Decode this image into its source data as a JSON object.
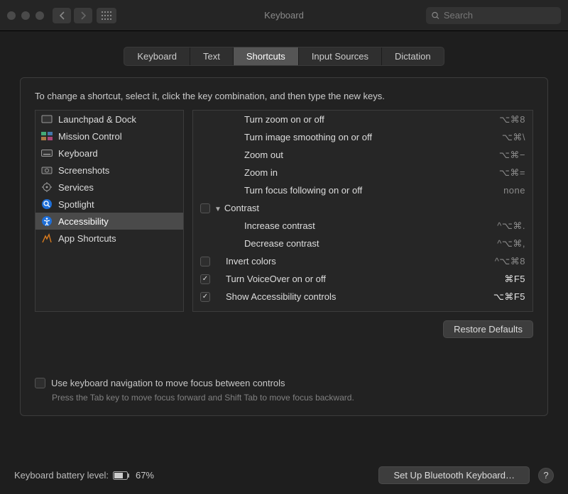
{
  "window": {
    "title": "Keyboard"
  },
  "search": {
    "placeholder": "Search"
  },
  "tabs": [
    {
      "label": "Keyboard",
      "active": false
    },
    {
      "label": "Text",
      "active": false
    },
    {
      "label": "Shortcuts",
      "active": true
    },
    {
      "label": "Input Sources",
      "active": false
    },
    {
      "label": "Dictation",
      "active": false
    }
  ],
  "instruction": "To change a shortcut, select it, click the key combination, and then type the new keys.",
  "categories": [
    {
      "id": "launchpad",
      "label": "Launchpad & Dock",
      "selected": false
    },
    {
      "id": "mission",
      "label": "Mission Control",
      "selected": false
    },
    {
      "id": "keyboard",
      "label": "Keyboard",
      "selected": false
    },
    {
      "id": "screenshots",
      "label": "Screenshots",
      "selected": false
    },
    {
      "id": "services",
      "label": "Services",
      "selected": false
    },
    {
      "id": "spotlight",
      "label": "Spotlight",
      "selected": false
    },
    {
      "id": "accessibility",
      "label": "Accessibility",
      "selected": true
    },
    {
      "id": "appshortcuts",
      "label": "App Shortcuts",
      "selected": false
    }
  ],
  "shortcuts": [
    {
      "type": "item",
      "checked": false,
      "label": "Turn zoom on or off",
      "key": "⌥⌘8",
      "bright": false
    },
    {
      "type": "item",
      "checked": false,
      "label": "Turn image smoothing on or off",
      "key": "⌥⌘\\",
      "bright": false
    },
    {
      "type": "item",
      "checked": false,
      "label": "Zoom out",
      "key": "⌥⌘−",
      "bright": false
    },
    {
      "type": "item",
      "checked": false,
      "label": "Zoom in",
      "key": "⌥⌘=",
      "bright": false
    },
    {
      "type": "item",
      "checked": false,
      "label": "Turn focus following on or off",
      "key": "none",
      "bright": false
    },
    {
      "type": "group",
      "checked": false,
      "label": "Contrast",
      "key": "",
      "bright": false
    },
    {
      "type": "item",
      "checked": false,
      "label": "Increase contrast",
      "key": "^⌥⌘.",
      "bright": false
    },
    {
      "type": "item",
      "checked": false,
      "label": "Decrease contrast",
      "key": "^⌥⌘,",
      "bright": false
    },
    {
      "type": "item",
      "checked": false,
      "label": "Invert colors",
      "key": "^⌥⌘8",
      "bright": false
    },
    {
      "type": "item",
      "checked": true,
      "label": "Turn VoiceOver on or off",
      "key": "⌘F5",
      "bright": true
    },
    {
      "type": "item",
      "checked": true,
      "label": "Show Accessibility controls",
      "key": "⌥⌘F5",
      "bright": true
    }
  ],
  "restore_label": "Restore Defaults",
  "keyboard_nav": {
    "label": "Use keyboard navigation to move focus between controls",
    "hint": "Press the Tab key to move focus forward and Shift Tab to move focus backward."
  },
  "footer": {
    "battery_label": "Keyboard battery level:",
    "battery_pct": "67%",
    "bluetooth_btn": "Set Up Bluetooth Keyboard…",
    "help": "?"
  }
}
